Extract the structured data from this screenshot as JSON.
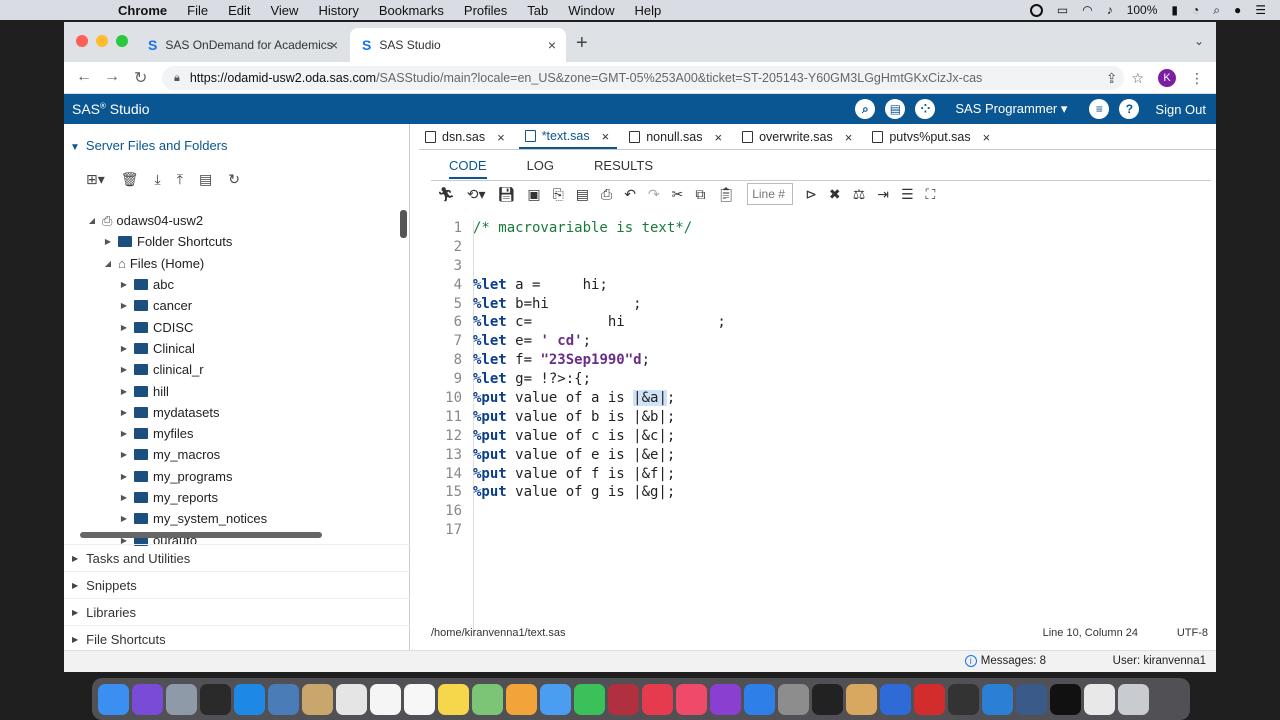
{
  "menubar": {
    "app": "Chrome",
    "items": [
      "File",
      "Edit",
      "View",
      "History",
      "Bookmarks",
      "Profiles",
      "Tab",
      "Window",
      "Help"
    ],
    "battery": "100%"
  },
  "browser": {
    "tabs": [
      {
        "title": "SAS OnDemand for Academics"
      },
      {
        "title": "SAS Studio"
      }
    ],
    "url_host": "https://odamid-usw2.oda.sas.com",
    "url_rest": "/SASStudio/main?locale=en_US&zone=GMT-05%253A00&ticket=ST-205143-Y60GM3LGgHmtGKxCizJx-cas",
    "profile_initial": "K"
  },
  "sas_header": {
    "title": "SAS",
    "title_sup": "®",
    "title_rest": " Studio",
    "role": "SAS Programmer",
    "sign_out": "Sign Out"
  },
  "left_panel": {
    "heading": "Server Files and Folders",
    "server": "odaws04-usw2",
    "folder_shortcuts": "Folder Shortcuts",
    "files_home": "Files (Home)",
    "folders": [
      "abc",
      "cancer",
      "CDISC",
      "Clinical",
      "clinical_r",
      "hill",
      "mydatasets",
      "myfiles",
      "my_macros",
      "my_programs",
      "my_reports",
      "my_system_notices",
      "ourauto"
    ],
    "sections": [
      "Tasks and Utilities",
      "Snippets",
      "Libraries",
      "File Shortcuts"
    ]
  },
  "editor": {
    "file_tabs": [
      "dsn.sas",
      "*text.sas",
      "nonull.sas",
      "overwrite.sas",
      "putvs%put.sas"
    ],
    "sub_tabs": [
      "CODE",
      "LOG",
      "RESULTS"
    ],
    "line_placeholder": "Line #",
    "lines": [
      {
        "n": "1",
        "parts": [
          [
            "cm",
            "/* macrovariable is text*/"
          ]
        ]
      },
      {
        "n": "2",
        "parts": []
      },
      {
        "n": "3",
        "parts": []
      },
      {
        "n": "4",
        "parts": [
          [
            "kw",
            "%let"
          ],
          [
            "",
            " a =     hi;"
          ]
        ]
      },
      {
        "n": "5",
        "parts": [
          [
            "kw",
            "%let"
          ],
          [
            "",
            " b=hi          ;"
          ]
        ]
      },
      {
        "n": "6",
        "parts": [
          [
            "kw",
            "%let"
          ],
          [
            "",
            " c=         hi           ;"
          ]
        ]
      },
      {
        "n": "7",
        "parts": [
          [
            "kw",
            "%let"
          ],
          [
            "",
            " e= "
          ],
          [
            "st",
            "' cd'"
          ],
          [
            "",
            ";"
          ]
        ]
      },
      {
        "n": "8",
        "parts": [
          [
            "kw",
            "%let"
          ],
          [
            "",
            " f= "
          ],
          [
            "st",
            "\"23Sep1990\"d"
          ],
          [
            "",
            ";"
          ]
        ]
      },
      {
        "n": "9",
        "parts": [
          [
            "kw",
            "%let"
          ],
          [
            "",
            " g= !?>:{;"
          ]
        ]
      },
      {
        "n": "10",
        "parts": [
          [
            "kw",
            "%put"
          ],
          [
            "",
            " value of a is "
          ],
          [
            "hl",
            "|&a|"
          ],
          [
            "",
            ";"
          ]
        ]
      },
      {
        "n": "11",
        "parts": [
          [
            "kw",
            "%put"
          ],
          [
            "",
            " value of b is |&b|;"
          ]
        ]
      },
      {
        "n": "12",
        "parts": [
          [
            "kw",
            "%put"
          ],
          [
            "",
            " value of c is |&c|;"
          ]
        ]
      },
      {
        "n": "13",
        "parts": [
          [
            "kw",
            "%put"
          ],
          [
            "",
            " value of e is |&e|;"
          ]
        ]
      },
      {
        "n": "14",
        "parts": [
          [
            "kw",
            "%put"
          ],
          [
            "",
            " value of f is |&f|;"
          ]
        ]
      },
      {
        "n": "15",
        "parts": [
          [
            "kw",
            "%put"
          ],
          [
            "",
            " value of g is |&g|;"
          ]
        ]
      },
      {
        "n": "16",
        "parts": []
      },
      {
        "n": "17",
        "parts": []
      }
    ],
    "path": "/home/kiranvenna1/text.sas",
    "position": "Line 10, Column 24",
    "encoding": "UTF-8"
  },
  "statusbar": {
    "messages": "Messages: 8",
    "user": "User: kiranvenna1"
  },
  "colors": {
    "sas_blue": "#0a5692",
    "comment": "#1a7a3a",
    "keyword": "#0a3d8f",
    "string": "#6b2c86"
  }
}
